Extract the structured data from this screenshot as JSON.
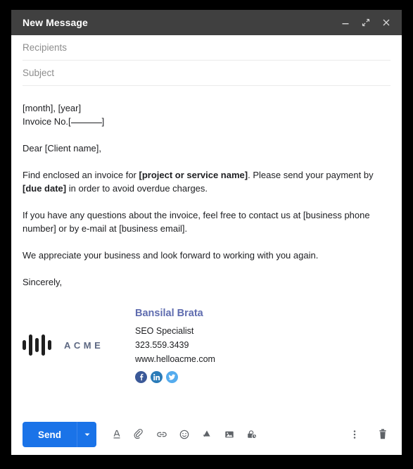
{
  "window": {
    "title": "New Message",
    "controls": [
      {
        "name": "minimize",
        "icon": "minimize-icon"
      },
      {
        "name": "expand",
        "icon": "expand-icon"
      },
      {
        "name": "close",
        "icon": "close-icon"
      }
    ]
  },
  "fields": {
    "recipients_placeholder": "Recipients",
    "subject_placeholder": "Subject",
    "recipients_value": "",
    "subject_value": ""
  },
  "body": {
    "date_line": "[month], [year]",
    "invoice_prefix": "Invoice No.[",
    "invoice_suffix": "]",
    "salutation": "Dear [Client name],",
    "para1_a": "Find enclosed an invoice for ",
    "para1_bold1": "[project or service name]",
    "para1_b": ". Please send your payment by ",
    "para1_bold2": "[due date]",
    "para1_c": " in order to avoid overdue charges.",
    "para2": "If you have any questions about the invoice, feel free to contact us at [business phone number] or by e-mail at [business email].",
    "para3": "We appreciate your business and look forward to working with you again.",
    "closing": "Sincerely,"
  },
  "signature": {
    "logo_word": "ACME",
    "logo_bars": [
      14,
      30,
      20,
      30,
      14
    ],
    "name": "Bansilal Brata",
    "title": "SEO Specialist",
    "phone": "323.559.3439",
    "website": "www.helloacme.com",
    "name_color": "#5f6caf",
    "social": [
      {
        "name": "facebook",
        "label": "f",
        "color": "#3b5998"
      },
      {
        "name": "linkedin",
        "label": "in",
        "color": "#2a7bb8"
      },
      {
        "name": "twitter",
        "label": "t",
        "color": "#55acee"
      }
    ]
  },
  "toolbar": {
    "send_label": "Send",
    "send_color": "#1a73e8",
    "send_caret_icon": "chevron-down-icon",
    "tools": [
      {
        "name": "formatting-options",
        "icon": "format-text-icon"
      },
      {
        "name": "attach-files",
        "icon": "paperclip-icon"
      },
      {
        "name": "insert-link",
        "icon": "link-icon"
      },
      {
        "name": "insert-emoji",
        "icon": "emoji-icon"
      },
      {
        "name": "insert-drive-file",
        "icon": "google-drive-icon"
      },
      {
        "name": "insert-photo",
        "icon": "image-icon"
      },
      {
        "name": "confidential-mode",
        "icon": "lock-clock-icon"
      }
    ],
    "more_options_icon": "kebab-menu-icon",
    "discard_icon": "trash-icon"
  }
}
